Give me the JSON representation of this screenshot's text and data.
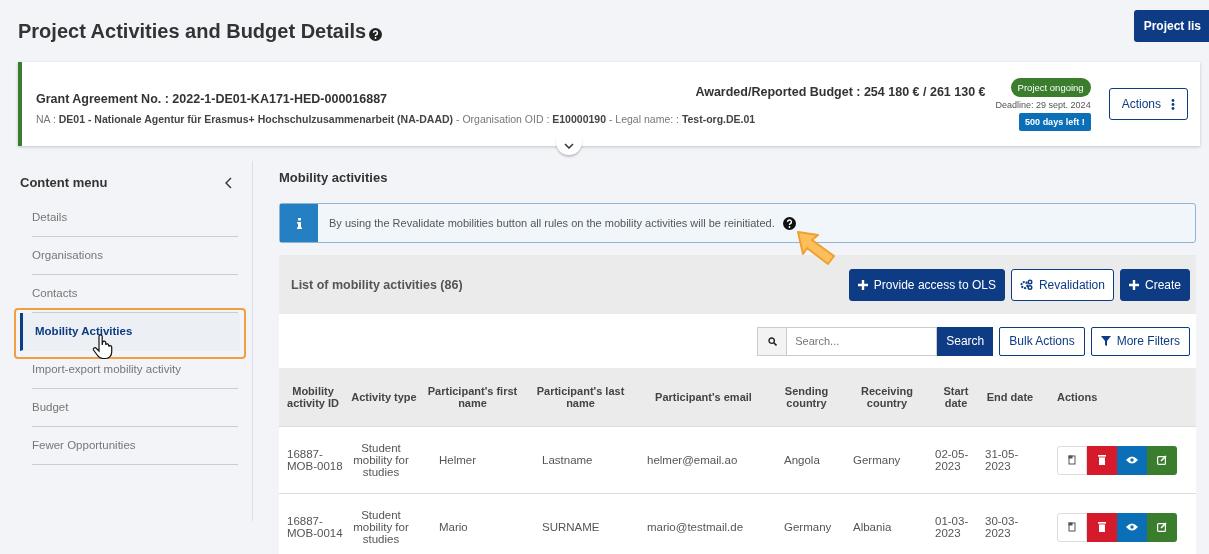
{
  "page": {
    "title": "Project Activities and Budget Details",
    "top_button": "Project lis"
  },
  "grant": {
    "agreement_label": "Grant Agreement No. : ",
    "agreement_no": "2022-1-DE01-KA171-HED-000016887",
    "details": "NA : **DE01 - Nationale Agentur für Erasmus+ Hochschulzusammenarbeit (NA-DAAD)** - Organisation OID : **E10000190** - Legal name: : **Test-org.DE.01**",
    "budget": "Awarded/Reported Budget : 254 180 € / 261 130 €",
    "status": "Project ongoing",
    "deadline": "Deadline: 29 sept. 2024",
    "days_left": "500 days left !",
    "actions_button": "Actions"
  },
  "sidebar": {
    "title": "Content menu",
    "items": [
      {
        "label": "Details",
        "selected": false
      },
      {
        "label": "Organisations",
        "selected": false
      },
      {
        "label": "Contacts",
        "selected": false
      },
      {
        "label": "Mobility Activities",
        "selected": true
      },
      {
        "label": "Import-export mobility activity",
        "selected": false
      },
      {
        "label": "Budget",
        "selected": false
      },
      {
        "label": "Fewer Opportunities",
        "selected": false
      }
    ]
  },
  "main": {
    "title": "Mobility activities",
    "info": "By using the Revalidate mobilities button all rules on the mobility activities will be reinitiated.",
    "list_title": "List of mobility activities (86)",
    "toolbar": [
      {
        "label": "Provide access to OLS",
        "kind": "add"
      },
      {
        "label": "Revalidation",
        "kind": "revalidate"
      },
      {
        "label": "Create",
        "kind": "add"
      }
    ],
    "search": {
      "placeholder": "Search...",
      "button": "Search"
    },
    "filters": [
      {
        "label": "Bulk Actions",
        "kind": "bulk"
      },
      {
        "label": "More Filters",
        "kind": "filter"
      }
    ],
    "table": {
      "columns": [
        "Mobility activity ID",
        "Activity type",
        "Participant's first name",
        "Participant's last name",
        "Participant's email",
        "Sending country",
        "Receiving country",
        "Start date",
        "End date",
        "Actions"
      ],
      "rows": [
        {
          "cells": [
            "16887-MOB-0018",
            "Student mobility for studies",
            "Helmer",
            "Lastname",
            "helmer@email.ao",
            "Angola",
            "Germany",
            "02-05-2023",
            "31-05-2023"
          ]
        },
        {
          "cells": [
            "16887-MOB-0014",
            "Student mobility for studies",
            "Mario",
            "SURNAME",
            "mario@testmail.de",
            "Germany",
            "Albania",
            "01-03-2023",
            "30-03-2023"
          ]
        }
      ],
      "row_actions": [
        {
          "kind": "copy"
        },
        {
          "kind": "delete"
        },
        {
          "kind": "view"
        },
        {
          "kind": "edit"
        }
      ]
    }
  }
}
